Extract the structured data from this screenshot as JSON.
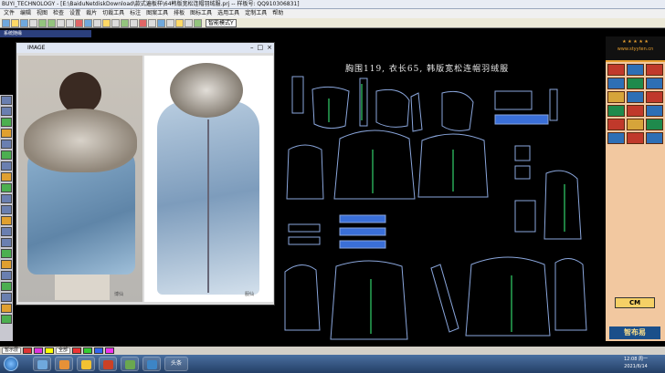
{
  "window": {
    "title": "BUYI_TECHNOLOGY - [E:\\BaiduNetdiskDownload\\款式遍板样\\64韩版宽松连帽羽绒服.prj -- 样板号: QQ910306831]"
  },
  "menu": {
    "items": [
      "文件",
      "编辑",
      "视图",
      "检查",
      "设置",
      "裁片",
      "切裁工具",
      "标注",
      "图案工具",
      "排板",
      "图标工具",
      "选用工具",
      "定制工具",
      "帮助"
    ]
  },
  "toolbar": {
    "mode_value": "智能模式Y"
  },
  "system_panel": {
    "label": "系统随缘"
  },
  "image_window": {
    "title": "IMAGE",
    "controls": [
      "–",
      "□",
      "×"
    ],
    "watermark_left": "博仙",
    "watermark_right": "服仙"
  },
  "canvas": {
    "heading": "胸围119, 衣长65, 韩版宽松连帽羽绒服"
  },
  "right_panel": {
    "header_top": "★ ★ ★ ★ ★",
    "header_site": "www.styyten.cn",
    "cm_label": "CM",
    "logo_text": "智布易"
  },
  "status": {
    "layer_field": "暂示层",
    "all_field": "全部"
  },
  "taskbar": {
    "app_label": "头条",
    "time": "12:08 周一",
    "date": "2021/6/14"
  },
  "colors": {
    "pattern_lines": "#8aa6dc",
    "grain_line": "#33d16a",
    "fill_blue": "#3a6fd8",
    "accent_orange": "#e8a030"
  }
}
